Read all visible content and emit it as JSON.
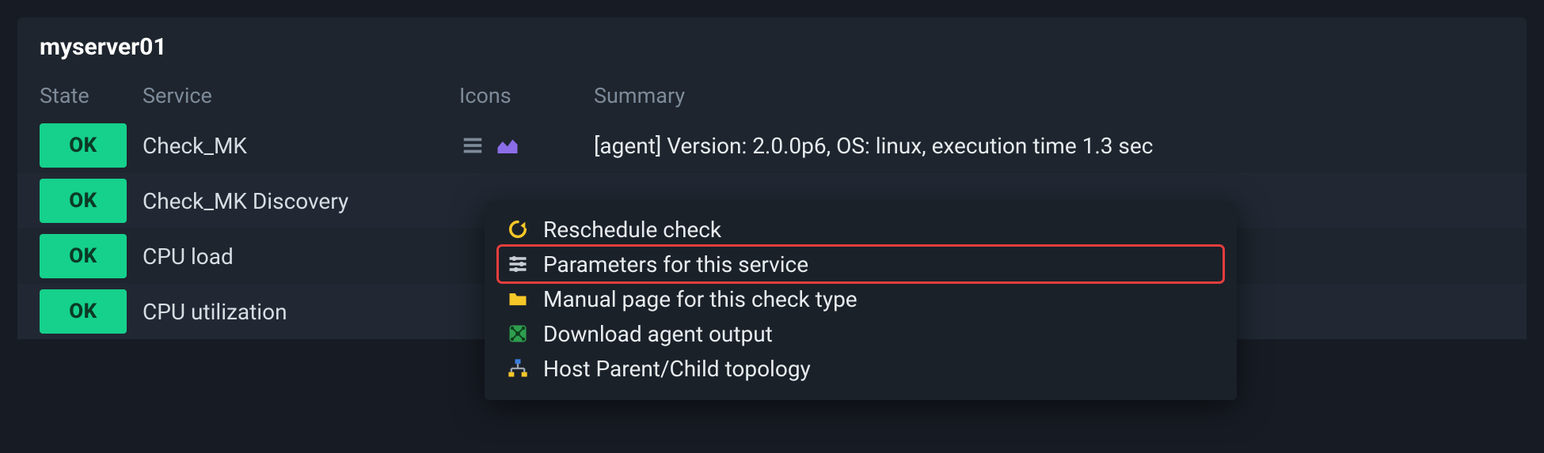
{
  "host": {
    "name": "myserver01"
  },
  "headers": {
    "state": "State",
    "service": "Service",
    "icons": "Icons",
    "summary": "Summary"
  },
  "state_label": "OK",
  "rows": [
    {
      "service": "Check_MK",
      "summary": "[agent] Version: 2.0.0p6, OS: linux, execution time 1.3 sec",
      "show_icons": true
    },
    {
      "service": "Check_MK Discovery",
      "summary": "",
      "show_icons": false
    },
    {
      "service": "CPU load",
      "summary": "",
      "show_icons": false
    },
    {
      "service": "CPU utilization",
      "summary": "",
      "show_icons": false
    }
  ],
  "context_menu": {
    "items": [
      {
        "label": "Reschedule check",
        "icon": "reload",
        "highlight": false
      },
      {
        "label": "Parameters for this service",
        "icon": "sliders",
        "highlight": true
      },
      {
        "label": "Manual page for this check type",
        "icon": "folder",
        "highlight": false
      },
      {
        "label": "Download agent output",
        "icon": "network",
        "highlight": false
      },
      {
        "label": "Host Parent/Child topology",
        "icon": "hierarchy",
        "highlight": false
      }
    ]
  },
  "colors": {
    "ok": "#15d18c",
    "highlight": "#e43d3d",
    "chart_icon": "#8c6de8"
  }
}
